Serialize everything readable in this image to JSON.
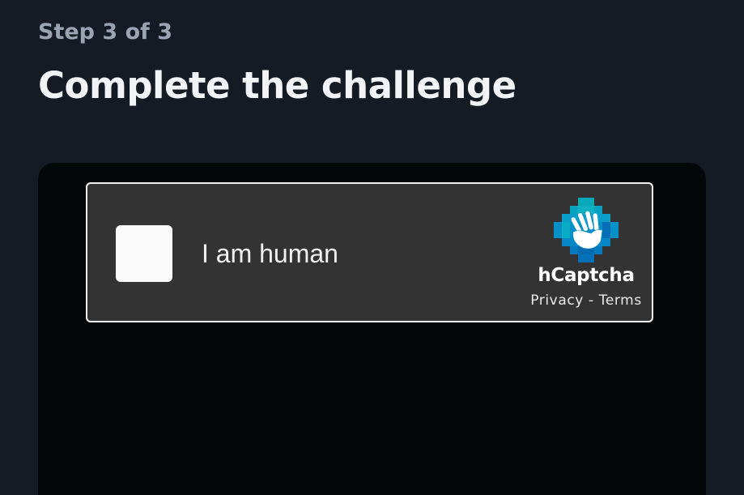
{
  "step": {
    "label": "Step 3 of 3"
  },
  "page": {
    "title": "Complete the challenge"
  },
  "captcha": {
    "checkbox_label": "I am human",
    "brand_name": "hCaptcha",
    "privacy_label": "Privacy",
    "separator": " - ",
    "terms_label": "Terms",
    "logo_icon": "hcaptcha-hand-icon",
    "colors": {
      "widget_background": "#333333",
      "widget_border": "#f2f2f2",
      "logo_teal": "#00a9c6",
      "logo_blue": "#0074bf"
    }
  }
}
